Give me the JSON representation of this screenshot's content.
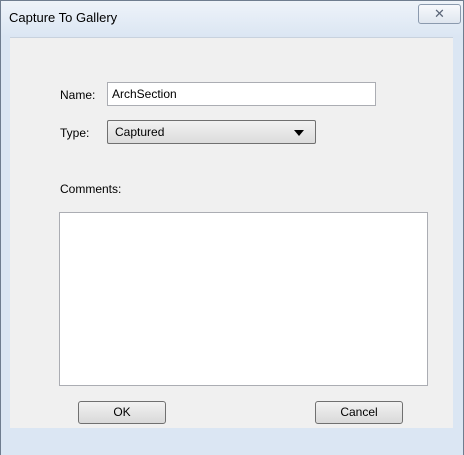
{
  "window": {
    "title": "Capture To Gallery",
    "close_glyph": "✕"
  },
  "form": {
    "name_label": "Name:",
    "name_value": "ArchSection",
    "type_label": "Type:",
    "type_value": "Captured",
    "comments_label": "Comments:",
    "comments_value": ""
  },
  "buttons": {
    "ok_label": "OK",
    "cancel_label": "Cancel"
  },
  "icons": {
    "close": "close-icon",
    "dropdown": "chevron-down-icon"
  }
}
